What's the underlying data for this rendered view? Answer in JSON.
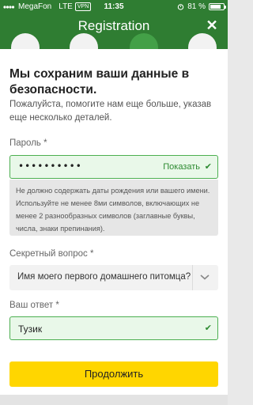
{
  "status_bar": {
    "carrier": "MegaFon",
    "network": "LTE",
    "vpn": "VPN",
    "time": "11:35",
    "battery_percent": "81 %",
    "battery_level": 0.81
  },
  "header": {
    "title": "Registration",
    "close_label": "✕",
    "steps_total": 4,
    "active_step": 3
  },
  "main": {
    "heading": "Мы сохраним ваши данные в безопасности.",
    "subtext": "Пожалуйста, помогите нам еще больше, указав еще несколько деталей.",
    "password": {
      "label": "Пароль *",
      "value_masked": "••••••••••",
      "show_label": "Показать",
      "hint": "Не должно содержать даты рождения или вашего имени. Используйте не менее 8ми символов, включающих не менее 2 разнообразных символов (заглавные буквы, числа, знаки препинания)."
    },
    "secret_question": {
      "label": "Секретный вопрос *",
      "selected": "Имя моего первого домашнего питомца?"
    },
    "answer": {
      "label": "Ваш ответ *",
      "value": "Тузик"
    },
    "submit_label": "Продолжить"
  },
  "colors": {
    "brand_green": "#2f7d32",
    "active_step": "#43a047",
    "valid_border": "#4caf50",
    "submit_yellow": "#ffd600"
  }
}
